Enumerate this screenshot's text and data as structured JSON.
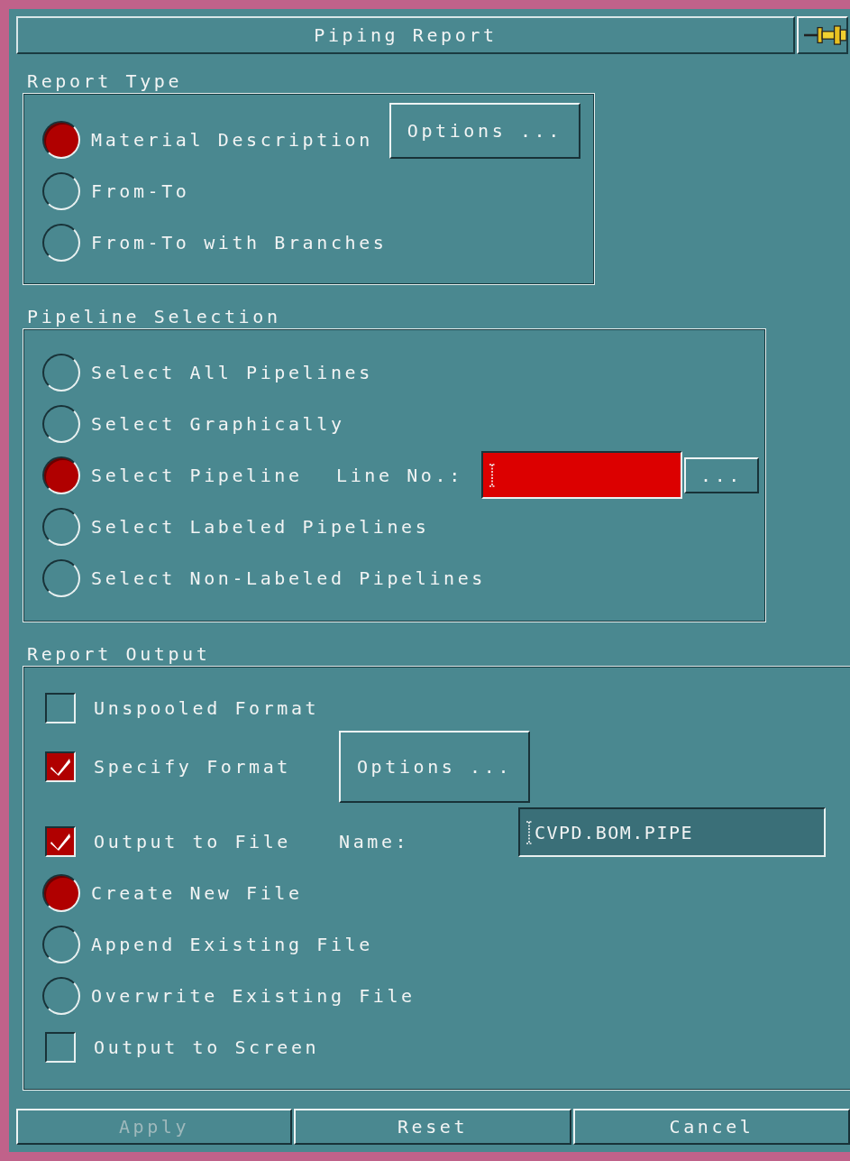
{
  "window": {
    "title": "Piping Report"
  },
  "report_type": {
    "label": "Report Type",
    "options_button": "Options ...",
    "options": [
      {
        "label": "Material Description",
        "selected": true
      },
      {
        "label": "From-To",
        "selected": false
      },
      {
        "label": "From-To with Branches",
        "selected": false
      }
    ]
  },
  "pipeline_selection": {
    "label": "Pipeline Selection",
    "options": [
      {
        "label": "Select All Pipelines",
        "selected": false
      },
      {
        "label": "Select Graphically",
        "selected": false
      },
      {
        "label": "Select Pipeline",
        "selected": true,
        "line_field": {
          "label": "Line No.:",
          "required": true,
          "browse_button": "..."
        }
      },
      {
        "label": "Select Labeled Pipelines",
        "selected": false
      },
      {
        "label": "Select Non-Labeled Pipelines",
        "selected": false
      }
    ]
  },
  "report_output": {
    "label": "Report Output",
    "items": [
      {
        "kind": "checkbox",
        "label": "Unspooled Format",
        "checked": false
      },
      {
        "kind": "checkbox",
        "label": "Specify Format",
        "checked": true,
        "button": "Options ..."
      },
      {
        "kind": "checkbox",
        "label": "Output to File",
        "checked": true,
        "field_label": "Name:",
        "field_value": "CVPD.BOM.PIPE"
      },
      {
        "kind": "radio",
        "label": "Create New File",
        "selected": true
      },
      {
        "kind": "radio",
        "label": "Append Existing File",
        "selected": false
      },
      {
        "kind": "radio",
        "label": "Overwrite Existing File",
        "selected": false
      },
      {
        "kind": "checkbox",
        "label": "Output to Screen",
        "checked": false
      }
    ]
  },
  "buttons": [
    {
      "label": "Apply",
      "disabled": true
    },
    {
      "label": "Reset",
      "disabled": false
    },
    {
      "label": "Cancel",
      "disabled": false
    }
  ]
}
